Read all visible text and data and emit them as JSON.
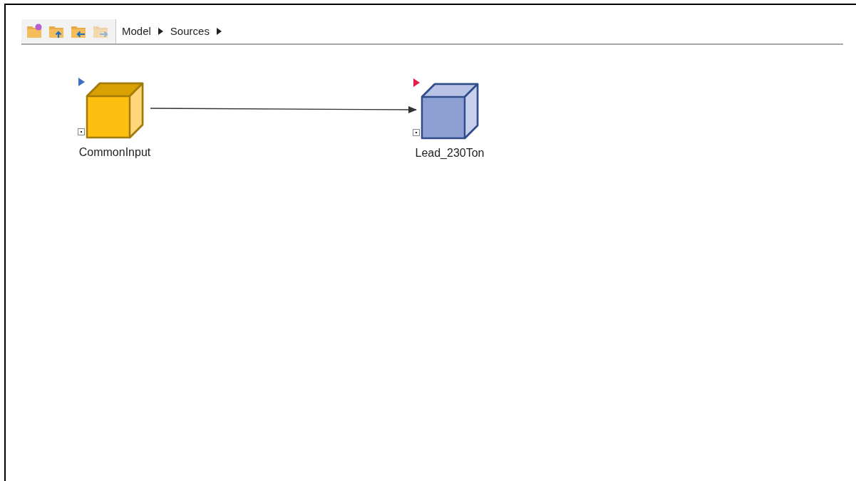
{
  "toolbar": {
    "buttons": [
      {
        "kind": "new",
        "disabled": false
      },
      {
        "kind": "up",
        "disabled": false
      },
      {
        "kind": "back",
        "disabled": false
      },
      {
        "kind": "forward",
        "disabled": true
      }
    ]
  },
  "breadcrumb": [
    "Model",
    "Sources"
  ],
  "canvas": {
    "nodes": [
      {
        "label": "CommonInput",
        "kind": "input"
      },
      {
        "label": "Lead_230Ton",
        "kind": "output"
      }
    ],
    "links": [
      {
        "kind": "arrow"
      }
    ]
  }
}
